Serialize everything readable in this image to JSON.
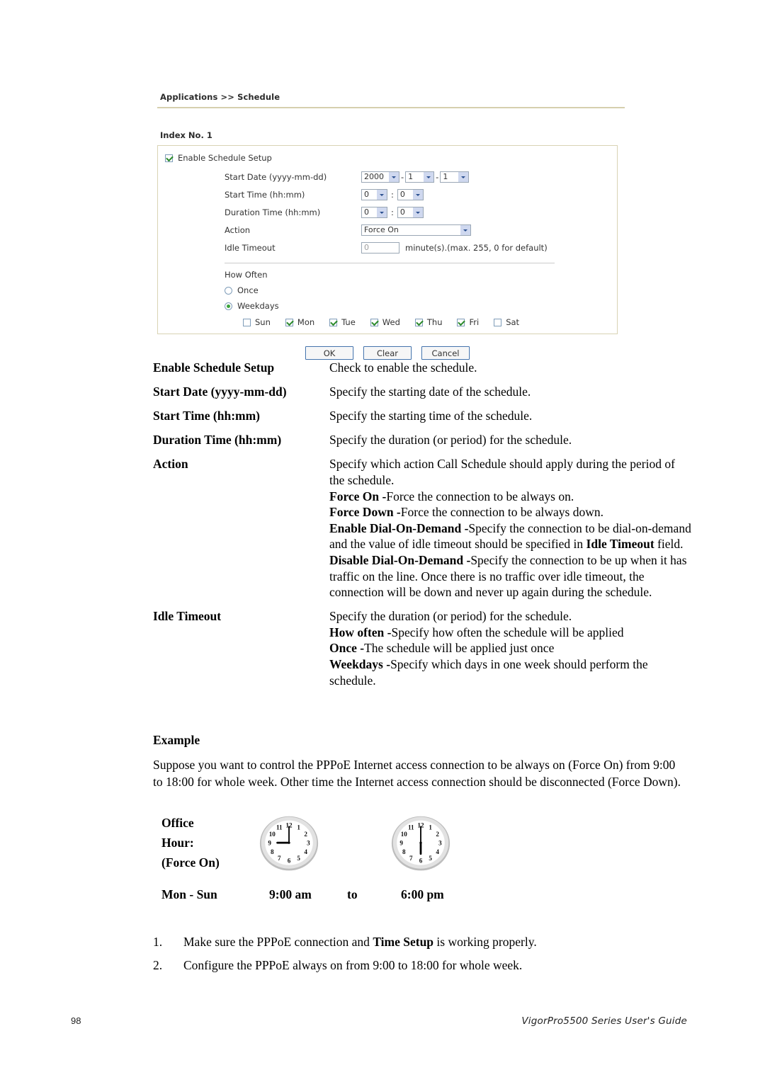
{
  "screenshot": {
    "breadcrumb": "Applications >> Schedule",
    "index_label": "Index No. 1",
    "enable_checkbox_label": "Enable Schedule Setup",
    "enable_checkbox_checked": true,
    "fields": {
      "start_date": {
        "label": "Start Date (yyyy-mm-dd)",
        "year": "2000",
        "month": "1",
        "day": "1",
        "separator": "-"
      },
      "start_time": {
        "label": "Start Time (hh:mm)",
        "hour": "0",
        "minute": "0",
        "separator": ":"
      },
      "duration_time": {
        "label": "Duration Time (hh:mm)",
        "hour": "0",
        "minute": "0",
        "separator": ":"
      },
      "action": {
        "label": "Action",
        "value": "Force On"
      },
      "idle_timeout": {
        "label": "Idle Timeout",
        "value": "0",
        "note": "minute(s).(max. 255, 0 for default)"
      }
    },
    "how_often": {
      "title": "How Often",
      "options": [
        {
          "label": "Once",
          "selected": false
        },
        {
          "label": "Weekdays",
          "selected": true
        }
      ],
      "days": [
        {
          "label": "Sun",
          "checked": false
        },
        {
          "label": "Mon",
          "checked": true
        },
        {
          "label": "Tue",
          "checked": true
        },
        {
          "label": "Wed",
          "checked": true
        },
        {
          "label": "Thu",
          "checked": true
        },
        {
          "label": "Fri",
          "checked": true
        },
        {
          "label": "Sat",
          "checked": false
        }
      ]
    },
    "buttons": {
      "ok": "OK",
      "clear": "Clear",
      "cancel": "Cancel"
    },
    "colors": {
      "panel_border": "#d9d3b4",
      "rule": "#d6cfae",
      "select_arrow": "#cfd8ef",
      "check_green": "#2a8a2a",
      "button_border": "#3e6ea8"
    }
  },
  "definitions": [
    {
      "term": "Enable Schedule Setup",
      "lines": [
        [
          {
            "t": "Check to enable the schedule.",
            "b": false
          }
        ]
      ]
    },
    {
      "term": "Start Date (yyyy-mm-dd)",
      "lines": [
        [
          {
            "t": "Specify the starting date of the schedule.",
            "b": false
          }
        ]
      ]
    },
    {
      "term": "Start Time (hh:mm)",
      "lines": [
        [
          {
            "t": "Specify the starting time of the schedule.",
            "b": false
          }
        ]
      ]
    },
    {
      "term": "Duration Time (hh:mm)",
      "lines": [
        [
          {
            "t": "Specify the duration (or period) for the schedule.",
            "b": false
          }
        ]
      ]
    },
    {
      "term": "Action",
      "lines": [
        [
          {
            "t": "Specify which action Call Schedule should apply during the period of the schedule.",
            "b": false
          }
        ],
        [
          {
            "t": "Force On -",
            "b": true
          },
          {
            "t": "Force the connection to be always on.",
            "b": false
          }
        ],
        [
          {
            "t": "Force Down -",
            "b": true
          },
          {
            "t": "Force the connection to be always down.",
            "b": false
          }
        ],
        [
          {
            "t": "Enable Dial-On-Demand -",
            "b": true
          },
          {
            "t": "Specify the connection to be dial-on-demand and the value of idle timeout should be specified in ",
            "b": false
          },
          {
            "t": "Idle Timeout",
            "b": true
          },
          {
            "t": " field.",
            "b": false
          }
        ],
        [
          {
            "t": "Disable Dial-On-Demand -",
            "b": true
          },
          {
            "t": "Specify the connection to be up when it has traffic on the line. Once there is no traffic over idle timeout, the connection will be down and never up again during the schedule.",
            "b": false
          }
        ]
      ]
    },
    {
      "term": "Idle Timeout",
      "lines": [
        [
          {
            "t": "Specify the duration (or period) for the schedule.",
            "b": false
          }
        ],
        [
          {
            "t": "How often -",
            "b": true
          },
          {
            "t": "Specify how often the schedule will be applied",
            "b": false
          }
        ],
        [
          {
            "t": "Once -",
            "b": true
          },
          {
            "t": "The schedule will be applied just once",
            "b": false
          }
        ],
        [
          {
            "t": "Weekdays -",
            "b": true
          },
          {
            "t": "Specify which days in one week should perform the schedule.",
            "b": false
          }
        ]
      ]
    }
  ],
  "example": {
    "heading": "Example",
    "paragraph": "Suppose you want to control the PPPoE Internet access connection to be always on (Force On) from 9:00 to 18:00 for whole week. Other time the Internet access connection should be disconnected (Force Down)."
  },
  "office_hour": {
    "label_line1": "Office",
    "label_line2": "Hour:",
    "label_line3": "(Force On)",
    "days_range": "Mon - Sun",
    "start_time": "9:00 am",
    "to_word": "to",
    "end_time": "6:00 pm",
    "clock_start": {
      "hour": 9,
      "minute": 0
    },
    "clock_end": {
      "hour": 6,
      "minute": 0
    },
    "clock_numerals": [
      "12",
      "1",
      "2",
      "3",
      "4",
      "5",
      "6",
      "7",
      "8",
      "9",
      "10",
      "11"
    ]
  },
  "steps": [
    {
      "num": "1.",
      "parts": [
        {
          "t": "Make sure the PPPoE connection and ",
          "b": false
        },
        {
          "t": "Time Setup",
          "b": true
        },
        {
          "t": " is working properly.",
          "b": false
        }
      ]
    },
    {
      "num": "2.",
      "parts": [
        {
          "t": "Configure the PPPoE always on from 9:00 to 18:00 for whole week.",
          "b": false
        }
      ]
    }
  ],
  "footer": {
    "page_number": "98",
    "guide_title": "VigorPro5500 Series User's Guide"
  }
}
